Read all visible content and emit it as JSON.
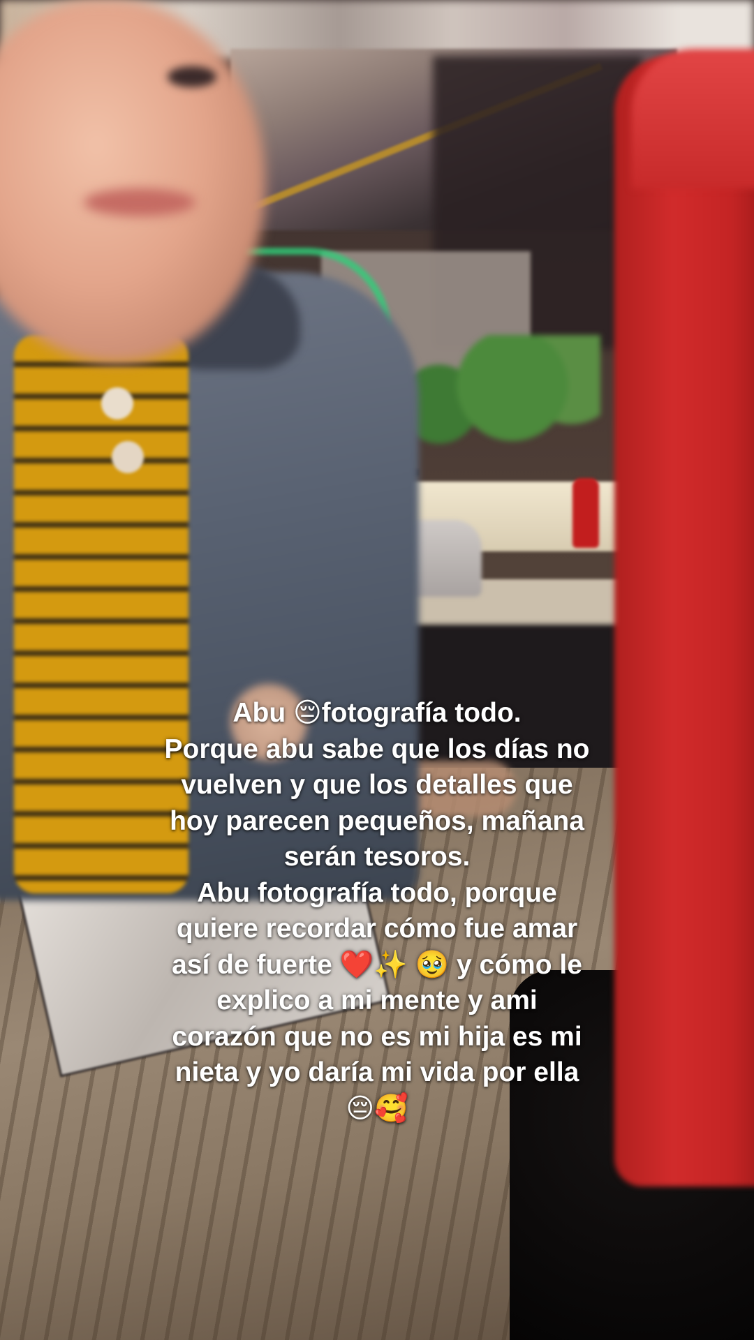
{
  "caption": {
    "lines": [
      "Abu 😔fotografía todo.",
      "Porque abu sabe que los días no",
      "vuelven y que los detalles que",
      "hoy parecen pequeños, mañana",
      "serán tesoros.",
      "Abu fotografía todo, porque",
      "quiere recordar cómo fue amar",
      "así de fuerte ❤️✨ 🥹 y cómo le",
      "explico a mi mente y ami",
      "corazón que no es mi hija es mi",
      "nieta y yo daría mi vida por ella",
      "😔🥰"
    ]
  },
  "colors": {
    "caption_text": "#ffffff",
    "ketchup_bottle": "#c42424",
    "shirt": "#d49a10",
    "jacket": "#596272",
    "table_wood": "#8a7864"
  }
}
